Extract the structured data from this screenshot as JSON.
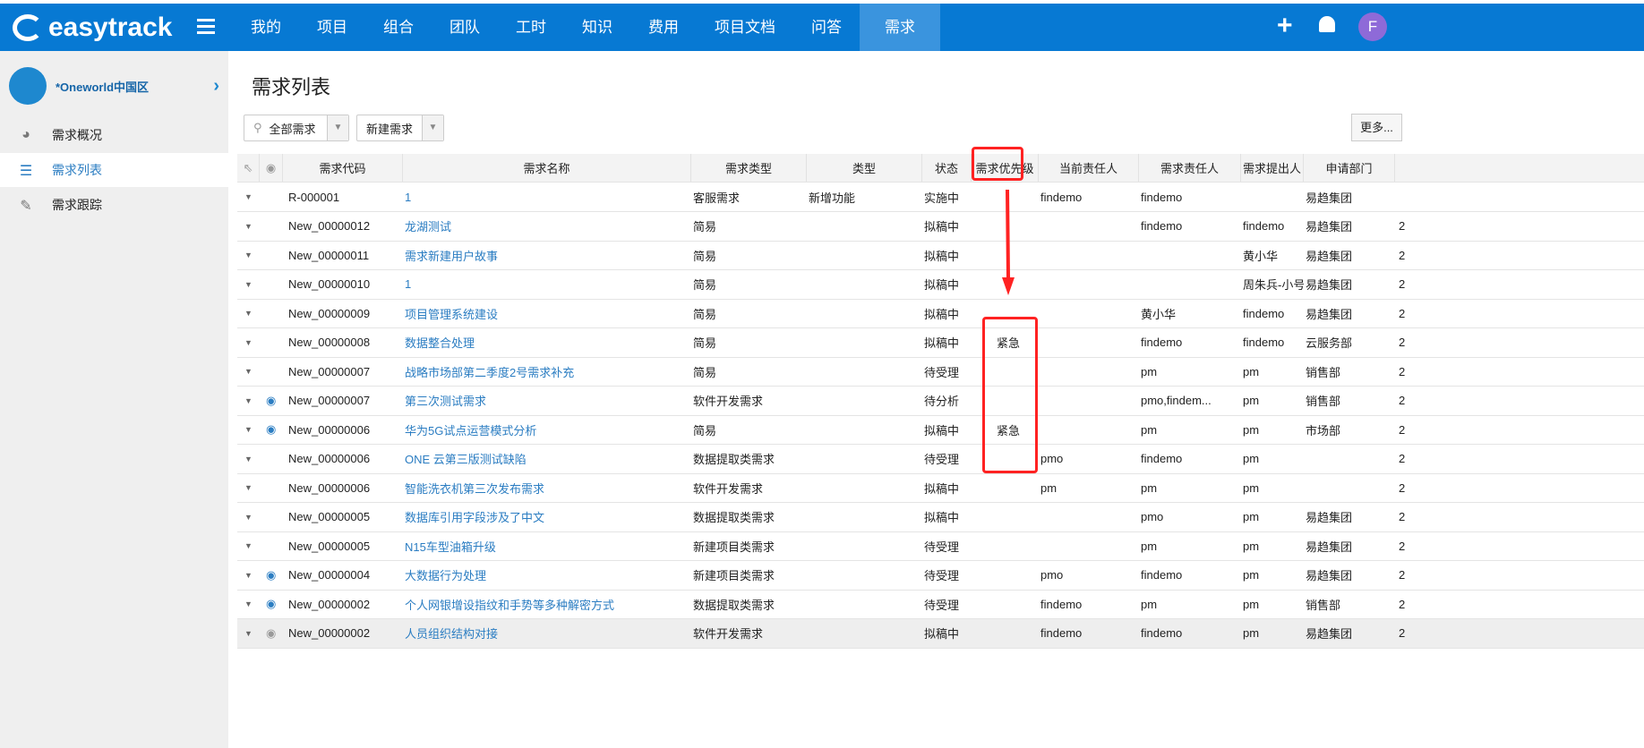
{
  "header": {
    "logo": "easytrack",
    "nav": [
      "我的",
      "项目",
      "组合",
      "团队",
      "工时",
      "知识",
      "费用",
      "项目文档",
      "问答",
      "需求"
    ],
    "active": "需求",
    "avatar": "F"
  },
  "sidebar": {
    "project": "*Oneworld中国区",
    "items": [
      "需求概况",
      "需求列表",
      "需求跟踪"
    ],
    "selected": "需求列表"
  },
  "page": {
    "title": "需求列表",
    "filter": "全部需求",
    "new_button": "新建需求",
    "more": "更多..."
  },
  "table": {
    "columns": [
      "需求代码",
      "需求名称",
      "需求类型",
      "类型",
      "状态",
      "需求优先级",
      "当前责任人",
      "需求责任人",
      "需求提出人",
      "申请部门"
    ],
    "rows": [
      {
        "eye": false,
        "code": "R-000001",
        "name": "1",
        "rtype": "客服需求",
        "type": "新增功能",
        "status": "实施中",
        "priority": "",
        "cur": "findemo",
        "owner": "findemo",
        "proposer": "",
        "dept": "易趋集团",
        "extra": ""
      },
      {
        "eye": false,
        "code": "New_00000012",
        "name": "龙湖测试",
        "rtype": "简易",
        "type": "",
        "status": "拟稿中",
        "priority": "",
        "cur": "",
        "owner": "findemo",
        "proposer": "findemo",
        "dept": "易趋集团",
        "extra": "2"
      },
      {
        "eye": false,
        "code": "New_00000011",
        "name": "需求新建用户故事",
        "rtype": "简易",
        "type": "",
        "status": "拟稿中",
        "priority": "",
        "cur": "",
        "owner": "",
        "proposer": "黄小华",
        "dept": "易趋集团",
        "extra": "2"
      },
      {
        "eye": false,
        "code": "New_00000010",
        "name": "1",
        "rtype": "简易",
        "type": "",
        "status": "拟稿中",
        "priority": "",
        "cur": "",
        "owner": "",
        "proposer": "周朱兵-小号",
        "dept": "易趋集团",
        "extra": "2"
      },
      {
        "eye": false,
        "code": "New_00000009",
        "name": "项目管理系统建设",
        "rtype": "简易",
        "type": "",
        "status": "拟稿中",
        "priority": "",
        "cur": "",
        "owner": "黄小华",
        "proposer": "findemo",
        "dept": "易趋集团",
        "extra": "2"
      },
      {
        "eye": false,
        "code": "New_00000008",
        "name": "数据整合处理",
        "rtype": "简易",
        "type": "",
        "status": "拟稿中",
        "priority": "紧急",
        "cur": "",
        "owner": "findemo",
        "proposer": "findemo",
        "dept": "云服务部",
        "extra": "2"
      },
      {
        "eye": false,
        "code": "New_00000007",
        "name": "战略市场部第二季度2号需求补充",
        "rtype": "简易",
        "type": "",
        "status": "待受理",
        "priority": "",
        "cur": "",
        "owner": "pm",
        "proposer": "pm",
        "dept": "销售部",
        "extra": "2"
      },
      {
        "eye": true,
        "code": "New_00000007",
        "name": "第三次测试需求",
        "rtype": "软件开发需求",
        "type": "",
        "status": "待分析",
        "priority": "",
        "cur": "",
        "owner": "pmo,findem...",
        "proposer": "pm",
        "dept": "销售部",
        "extra": "2"
      },
      {
        "eye": true,
        "code": "New_00000006",
        "name": "华为5G试点运营模式分析",
        "rtype": "简易",
        "type": "",
        "status": "拟稿中",
        "priority": "紧急",
        "cur": "",
        "owner": "pm",
        "proposer": "pm",
        "dept": "市场部",
        "extra": "2"
      },
      {
        "eye": false,
        "code": "New_00000006",
        "name": "ONE 云第三版测试缺陷",
        "rtype": "数据提取类需求",
        "type": "",
        "status": "待受理",
        "priority": "",
        "cur": "pmo",
        "owner": "findemo",
        "proposer": "pm",
        "dept": "",
        "extra": "2"
      },
      {
        "eye": false,
        "code": "New_00000006",
        "name": "智能洗衣机第三次发布需求",
        "rtype": "软件开发需求",
        "type": "",
        "status": "拟稿中",
        "priority": "",
        "cur": "pm",
        "owner": "pm",
        "proposer": "pm",
        "dept": "",
        "extra": "2"
      },
      {
        "eye": false,
        "code": "New_00000005",
        "name": "数据库引用字段涉及了中文",
        "rtype": "数据提取类需求",
        "type": "",
        "status": "拟稿中",
        "priority": "",
        "cur": "",
        "owner": "pmo",
        "proposer": "pm",
        "dept": "易趋集团",
        "extra": "2"
      },
      {
        "eye": false,
        "code": "New_00000005",
        "name": "N15车型油箱升级",
        "rtype": "新建项目类需求",
        "type": "",
        "status": "待受理",
        "priority": "",
        "cur": "",
        "owner": "pm",
        "proposer": "pm",
        "dept": "易趋集团",
        "extra": "2"
      },
      {
        "eye": true,
        "code": "New_00000004",
        "name": "大数据行为处理",
        "rtype": "新建项目类需求",
        "type": "",
        "status": "待受理",
        "priority": "",
        "cur": "pmo",
        "owner": "findemo",
        "proposer": "pm",
        "dept": "易趋集团",
        "extra": "2"
      },
      {
        "eye": true,
        "code": "New_00000002",
        "name": "个人网银增设指纹和手势等多种解密方式",
        "rtype": "数据提取类需求",
        "type": "",
        "status": "待受理",
        "priority": "",
        "cur": "findemo",
        "owner": "pm",
        "proposer": "pm",
        "dept": "销售部",
        "extra": "2"
      },
      {
        "eye": true,
        "code": "New_00000002",
        "name": "人员组织结构对接",
        "rtype": "软件开发需求",
        "type": "",
        "status": "拟稿中",
        "priority": "",
        "cur": "findemo",
        "owner": "findemo",
        "proposer": "pm",
        "dept": "易趋集团",
        "extra": "2"
      }
    ]
  },
  "colors": {
    "brand": "#0779d3",
    "link": "#2b7dc2",
    "annotation": "#ff2222"
  }
}
